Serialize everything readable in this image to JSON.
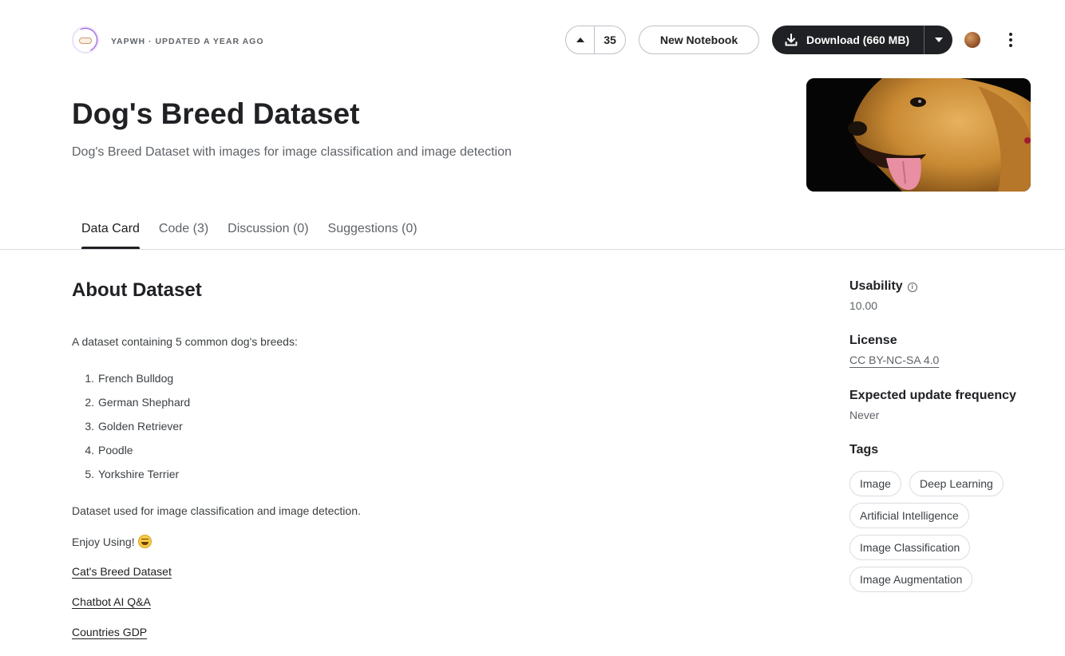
{
  "header": {
    "owner_meta": "YAPWH · UPDATED A YEAR AGO",
    "vote_count": "35",
    "new_notebook_label": "New Notebook",
    "download_label": "Download (660 MB)",
    "title": "Dog's Breed Dataset",
    "subtitle": "Dog's Breed Dataset with images for image classification and image detection"
  },
  "tabs": [
    {
      "label": "Data Card",
      "active": true
    },
    {
      "label": "Code (3)",
      "active": false
    },
    {
      "label": "Discussion (0)",
      "active": false
    },
    {
      "label": "Suggestions (0)",
      "active": false
    }
  ],
  "about": {
    "heading": "About Dataset",
    "intro": "A dataset containing 5 common dog's breeds:",
    "breeds": [
      {
        "num": "1.",
        "name": "French Bulldog"
      },
      {
        "num": "2.",
        "name": "German Shephard"
      },
      {
        "num": "3.",
        "name": "Golden Retriever"
      },
      {
        "num": "4.",
        "name": "Poodle"
      },
      {
        "num": "5.",
        "name": "Yorkshire Terrier"
      }
    ],
    "usage": "Dataset used for image classification and image detection.",
    "enjoy": "Enjoy Using!",
    "links": [
      "Cat's Breed Dataset",
      "Chatbot AI Q&A",
      "Countries GDP"
    ]
  },
  "sidebar": {
    "usability_label": "Usability",
    "usability_value": "10.00",
    "license_label": "License",
    "license_value": "CC BY-NC-SA 4.0",
    "frequency_label": "Expected update frequency",
    "frequency_value": "Never",
    "tags_label": "Tags",
    "tags": [
      "Image",
      "Deep Learning",
      "Artificial Intelligence",
      "Image Classification",
      "Image Augmentation"
    ]
  },
  "colors": {
    "primary_text": "#202124",
    "secondary_text": "#5f6368",
    "download_bg": "#202124",
    "border": "#dadce0"
  },
  "icons": [
    "owner-avatar",
    "upvote-icon",
    "download-icon",
    "caret-down-icon",
    "user-avatar",
    "more-vert-icon",
    "info-icon",
    "grinning-emoji-icon"
  ]
}
